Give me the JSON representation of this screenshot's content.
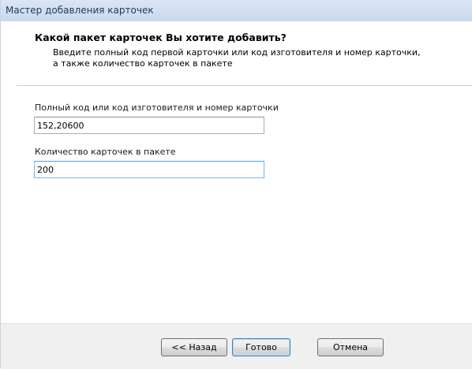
{
  "window": {
    "title": "Мастер добавления карточек"
  },
  "header": {
    "title": "Какой пакет карточек Вы хотите добавить?",
    "description": "Введите полный код первой карточки или код изготовителя и номер карточки, а также количество карточек в пакете"
  },
  "form": {
    "full_code": {
      "label": "Полный код или код изготовителя и номер карточки",
      "value": "152,20600"
    },
    "quantity": {
      "label": "Количество карточек в пакете",
      "value": "200"
    }
  },
  "footer": {
    "back_label": "<< Назад",
    "finish_label": "Готово",
    "cancel_label": "Отмена"
  }
}
